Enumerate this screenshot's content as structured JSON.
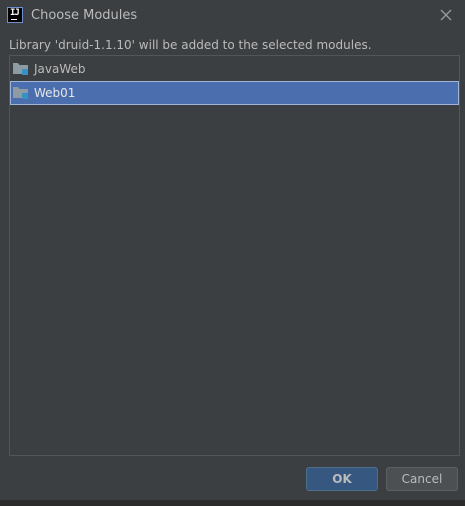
{
  "window": {
    "title": "Choose Modules",
    "app_icon": "intellij-idea-icon",
    "close_icon": "close-icon"
  },
  "message": "Library 'druid-1.1.10' will be added to the selected modules.",
  "modules": [
    {
      "label": "JavaWeb",
      "icon": "module-folder-icon",
      "selected": false
    },
    {
      "label": "Web01",
      "icon": "module-folder-icon",
      "selected": true
    }
  ],
  "buttons": {
    "ok_label": "OK",
    "cancel_label": "Cancel"
  },
  "colors": {
    "background": "#3c3f41",
    "selection": "#4b6eaf",
    "ok_button": "#365880",
    "text": "#bbbbbb"
  }
}
